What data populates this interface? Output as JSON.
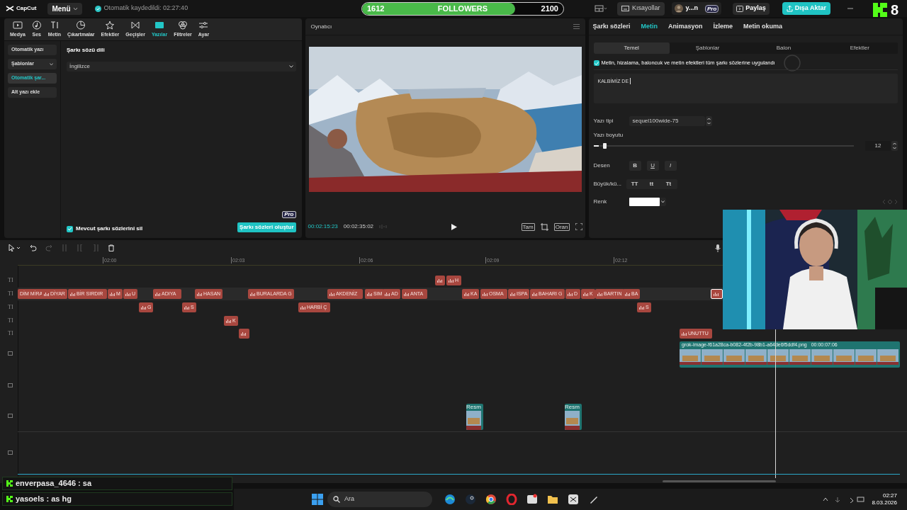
{
  "app_bar": {
    "app_name": "CapCut",
    "menu": "Menü",
    "autosave": "Otomatik kaydedildi: 02:27:40",
    "shortcuts": "Kısayollar",
    "user": "y...n",
    "user_badge": "Pro",
    "share": "Paylaş",
    "export": "Dışa Aktar"
  },
  "follower_goal": {
    "current": "1612",
    "label": "FOLLOWERS",
    "target": "2100",
    "level": 0.76
  },
  "stream_badge": {
    "count": "8"
  },
  "media_tabs": [
    {
      "label": "Medya",
      "selected": false
    },
    {
      "label": "Ses",
      "selected": false
    },
    {
      "label": "Metin",
      "selected": false
    },
    {
      "label": "Çıkartmalar",
      "selected": false
    },
    {
      "label": "Efektler",
      "selected": false
    },
    {
      "label": "Geçişler",
      "selected": false
    },
    {
      "label": "Yazılar",
      "selected": true
    },
    {
      "label": "Filtreler",
      "selected": false
    },
    {
      "label": "Ayar",
      "selected": false
    }
  ],
  "left_sidebar": [
    {
      "label": "Otomatik yazı",
      "selected": false,
      "dropdown": false
    },
    {
      "label": "Şablonlar",
      "selected": false,
      "dropdown": true
    },
    {
      "label": "Otomatik şar...",
      "selected": true,
      "dropdown": false
    },
    {
      "label": "Alt yazı ekle",
      "selected": false,
      "dropdown": false
    }
  ],
  "lyrics_panel": {
    "language_label": "Şarkı sözü dili",
    "language": "İngilizce",
    "clear_existing": {
      "label": "Mevcut şarkı sözlerini sil",
      "checked": true
    },
    "generate": "Şarkı sözleri oluştur",
    "generate_badge": "Pro"
  },
  "player": {
    "title": "Oynatıcı",
    "current_time": "00:02:15:23",
    "total_time": "00:02:35:02",
    "full_label": "Tam",
    "ratio_label": "Oran"
  },
  "inspector": {
    "tabs": [
      {
        "label": "Şarkı sözleri",
        "selected": false
      },
      {
        "label": "Metin",
        "selected": true
      },
      {
        "label": "Animasyon",
        "selected": false
      },
      {
        "label": "İzleme",
        "selected": false
      },
      {
        "label": "Metin okuma",
        "selected": false
      }
    ],
    "subtabs": [
      {
        "label": "Temel",
        "selected": true
      },
      {
        "label": "Şablonlar",
        "selected": false
      },
      {
        "label": "Balon",
        "selected": false
      },
      {
        "label": "Efektler",
        "selected": false
      }
    ],
    "apply_all": {
      "label": "Metin, hizalama, baloncuk ve metin efektleri tüm şarkı sözlerine uygulandı",
      "checked": true
    },
    "text_value": "KALBİMİZ DE",
    "font_label": "Yazı tipi",
    "font": "sequel100wide-75",
    "size_label": "Yazı boyutu",
    "size": {
      "level": 0.02,
      "value": "12"
    },
    "style_label": "Desen",
    "styles": [
      "B",
      "U",
      "I"
    ],
    "case_label": "Büyük/kü...",
    "cases": [
      "TT",
      "tt",
      "Tt"
    ],
    "color_label": "Renk",
    "color": "#ffffff"
  },
  "timeline": {
    "ruler": [
      "02:00",
      "02:03",
      "02:06",
      "02:09",
      "02:12"
    ],
    "text_tracks": [
      {
        "header": "TI",
        "clips": [
          {
            "selected": false
          },
          {
            "label": "H",
            "selected": false
          }
        ]
      },
      {
        "header": "TI",
        "clips": [
          {
            "label": "DİM MİRA",
            "selected": false
          },
          {
            "label": "DİYAR",
            "selected": false
          },
          {
            "label": "BİR SIRDIR",
            "selected": false
          },
          {
            "label": "M",
            "selected": false
          },
          {
            "label": "U",
            "selected": false
          },
          {
            "label": "ADIYA",
            "selected": false
          },
          {
            "label": "HASAN",
            "selected": false
          },
          {
            "label": "BURALARDA G",
            "selected": false
          },
          {
            "label": "AKDENİZ",
            "selected": false
          },
          {
            "label": "SIM",
            "selected": false
          },
          {
            "label": "AD",
            "selected": false
          },
          {
            "label": "ANTA",
            "selected": false
          },
          {
            "label": "KA",
            "selected": false
          },
          {
            "label": "OSMA",
            "selected": false
          },
          {
            "label": "ISPA",
            "selected": false
          },
          {
            "label": "BAHARI G",
            "selected": false
          },
          {
            "label": "D",
            "selected": false
          },
          {
            "label": "K",
            "selected": false
          },
          {
            "label": "BARTIN",
            "selected": false
          },
          {
            "label": "BA",
            "selected": false
          },
          {
            "selected": true
          }
        ]
      },
      {
        "header": "TI",
        "clips": [
          {
            "label": "G",
            "selected": false
          },
          {
            "label": "S",
            "selected": false
          },
          {
            "label": "HARBİ Ç",
            "selected": false
          },
          {
            "label": "S",
            "selected": false
          }
        ]
      },
      {
        "header": "TI",
        "clips": [
          {
            "label": "K",
            "selected": false
          }
        ]
      },
      {
        "header": "TI",
        "clips": [
          {
            "selected": false
          },
          {
            "label": "UNUTTU",
            "selected": false
          }
        ]
      }
    ],
    "media_tracks": [
      {
        "kind": "filled",
        "clips": [
          {
            "label": "grok-image-f61a28ca-b082-4f2b-98b1-a64de6f5ddf4.png",
            "duration": "00:00:07:06"
          }
        ]
      },
      {
        "kind": "empty"
      },
      {
        "kind": "filled",
        "clips": [
          {
            "label": "Resm"
          },
          {
            "label": "Resm"
          }
        ]
      },
      {
        "kind": "empty"
      }
    ]
  },
  "chat": [
    {
      "text": "enverpasa_4646 : sa"
    },
    {
      "text": "yasoels : as hg"
    }
  ],
  "taskbar": {
    "search": "Ara",
    "time": "02:27",
    "date": "8.03.2026"
  }
}
